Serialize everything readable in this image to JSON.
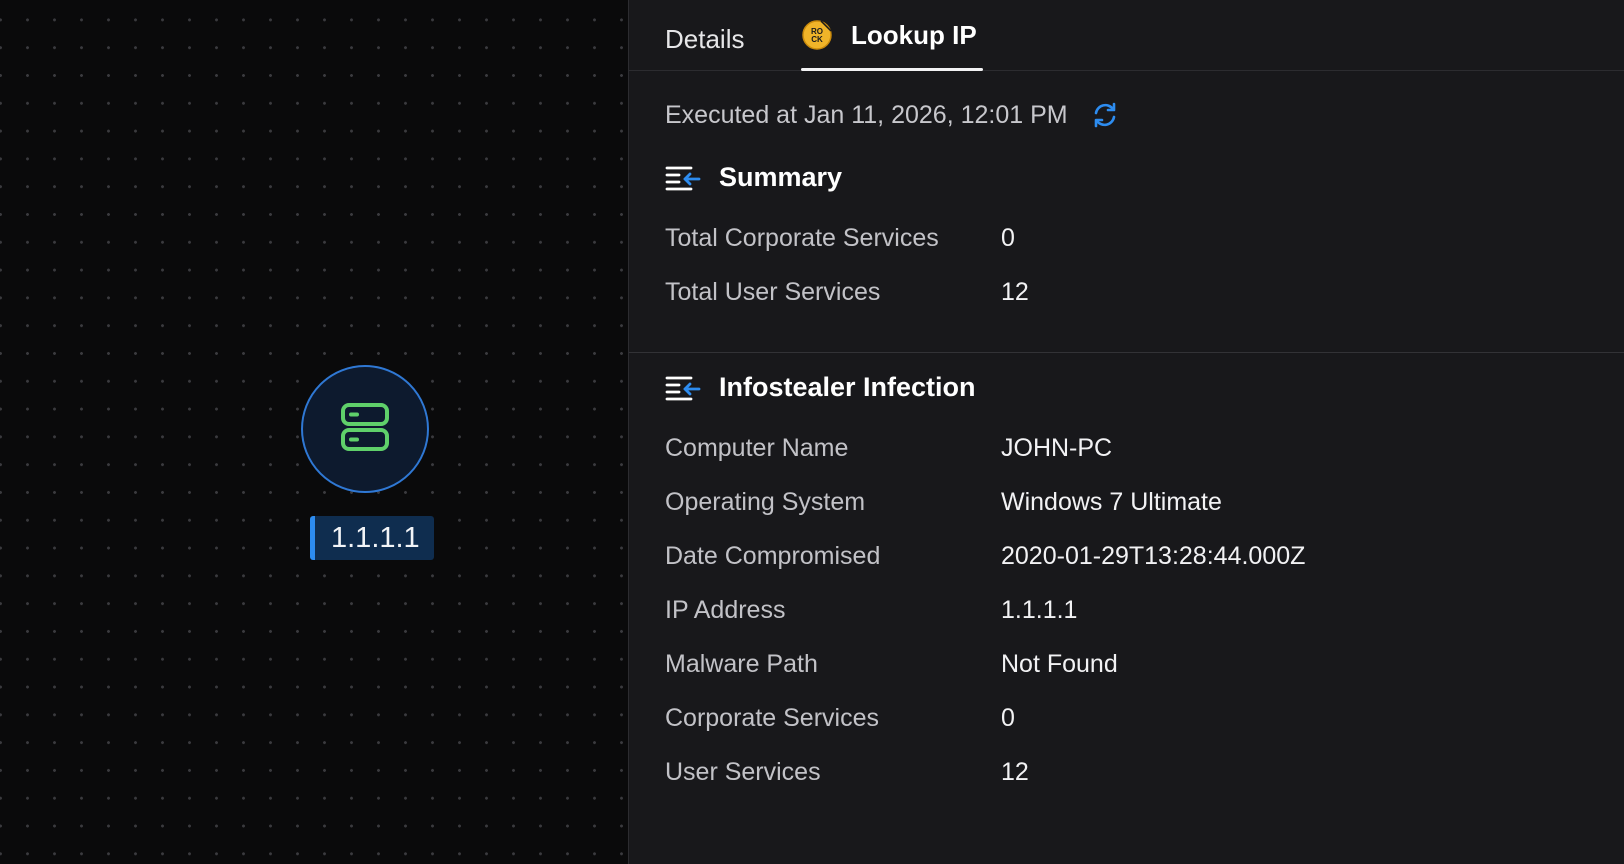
{
  "graph": {
    "node": {
      "label": "1.1.1.1",
      "icon": "server-icon",
      "accent": "#2f78d4",
      "icon_color": "#5fd06a"
    }
  },
  "tabs": [
    {
      "label": "Details",
      "active": false
    },
    {
      "label": "Lookup IP",
      "active": true,
      "icon": "rock-logo-icon"
    }
  ],
  "executed": {
    "text": "Executed at Jan 11, 2026, 12:01 PM",
    "icon": "refresh-icon",
    "icon_color": "#2d8cf0"
  },
  "summary": {
    "title": "Summary",
    "rows": [
      {
        "label": "Total Corporate Services",
        "value": "0"
      },
      {
        "label": "Total User Services",
        "value": "12"
      }
    ]
  },
  "infection": {
    "title": "Infostealer Infection",
    "rows": [
      {
        "label": "Computer Name",
        "value": "JOHN-PC"
      },
      {
        "label": "Operating System",
        "value": "Windows 7 Ultimate"
      },
      {
        "label": "Date Compromised",
        "value": "2020-01-29T13:28:44.000Z"
      },
      {
        "label": "IP Address",
        "value": "1.1.1.1"
      },
      {
        "label": "Malware Path",
        "value": "Not Found"
      },
      {
        "label": "Corporate Services",
        "value": "0"
      },
      {
        "label": "User Services",
        "value": "12"
      }
    ]
  }
}
